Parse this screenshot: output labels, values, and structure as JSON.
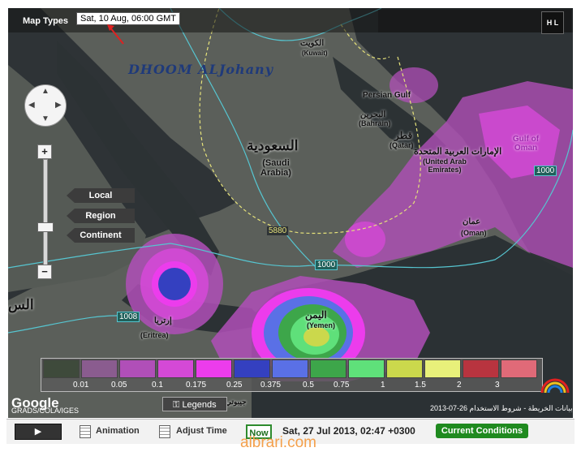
{
  "header": {
    "map_types": "Map Types",
    "timestamp": "Sat, 10 Aug, 06:00 GMT",
    "hl_icon": "H L"
  },
  "watermark_text": "DHOOM ALJohany",
  "nav": {
    "views": [
      "Local",
      "Region",
      "Continent"
    ]
  },
  "map_labels": {
    "kuwait_ar": "الكويت",
    "kuwait_en": "(Kuwait)",
    "persian_gulf": "Persian Gulf",
    "bahrain_ar": "البحرين",
    "bahrain_en": "(Bahrain)",
    "qatar_ar": "قطر",
    "qatar_en": "(Qatar)",
    "uae_ar": "الإمارات العربية المتحدة",
    "uae_en": "(United Arab Emirates)",
    "gulf_of_oman": "Gulf of Oman",
    "saudi_ar": "السعودية",
    "saudi_en": "(Saudi Arabia)",
    "oman_ar": "عمان",
    "oman_en": "(Oman)",
    "eritrea_ar": "إرتريا",
    "eritrea_en": "(Eritrea)",
    "yemen_ar": "اليمن",
    "yemen_en": "(Yemen)",
    "contour_5880": "5880",
    "contour_1000_a": "1000",
    "contour_1000_b": "1000",
    "contour_1008": "1008",
    "left_edge_ar": "الس",
    "ar_partial": "جيبوتي"
  },
  "legend": {
    "labels": [
      "0.01",
      "0.05",
      "0.1",
      "0.175",
      "0.25",
      "0.375",
      "0.5",
      "0.75",
      "1",
      "1.5",
      "2",
      "3"
    ],
    "colors": [
      "#3e4a3b",
      "#8a5c8f",
      "#b04fb8",
      "#d449d6",
      "#ec3cec",
      "#3440c0",
      "#5a70e6",
      "#3da64a",
      "#5fe07a",
      "#cbd84c",
      "#e8f07a",
      "#b8343f",
      "#e06a78"
    ]
  },
  "footer_map": {
    "google": "Google",
    "grads": "GRADS/COLA/IGES",
    "legends_label": "Legends",
    "copyright": "2013-07-26 بيانات الخريطة - شروط الاستخدام"
  },
  "controls": {
    "play_icon": "play-icon",
    "animation_label": "Animation",
    "adjust_time_label": "Adjust Time",
    "now_label": "Now",
    "current_time": "Sat, 27 Jul 2013, 02:47 +0300",
    "conditions_label": "Current Conditions"
  },
  "bottom_watermark": "albrari.com"
}
